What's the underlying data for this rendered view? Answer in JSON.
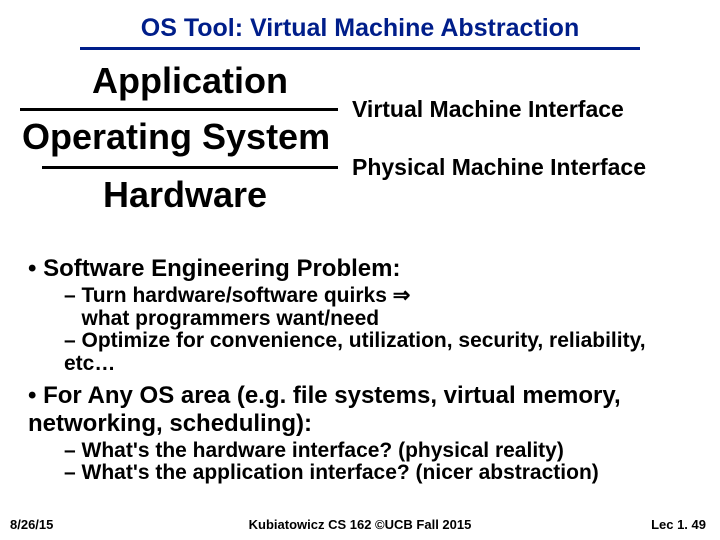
{
  "title": "OS Tool: Virtual Machine Abstraction",
  "layers": {
    "app": "Application",
    "os": "Operating System",
    "hw": "Hardware"
  },
  "interfaces": {
    "vmi": "Virtual Machine Interface",
    "pmi": "Physical Machine Interface"
  },
  "bullets": {
    "b1": "Software Engineering Problem:",
    "b1a": "Turn hardware/software quirks ",
    "b1a2": "what programmers want/need",
    "b1b": "Optimize for convenience, utilization, security, reliability, etc…",
    "b2": "For Any OS area (e.g. file systems, virtual memory, networking, scheduling):",
    "b2a": "What's the hardware interface? (physical reality)",
    "b2b": "What's the application interface? (nicer abstraction)"
  },
  "footer": {
    "date": "8/26/15",
    "course": "Kubiatowicz CS 162 ©UCB Fall 2015",
    "page": "Lec 1. 49"
  },
  "glyphs": {
    "arrow": "⇒"
  }
}
